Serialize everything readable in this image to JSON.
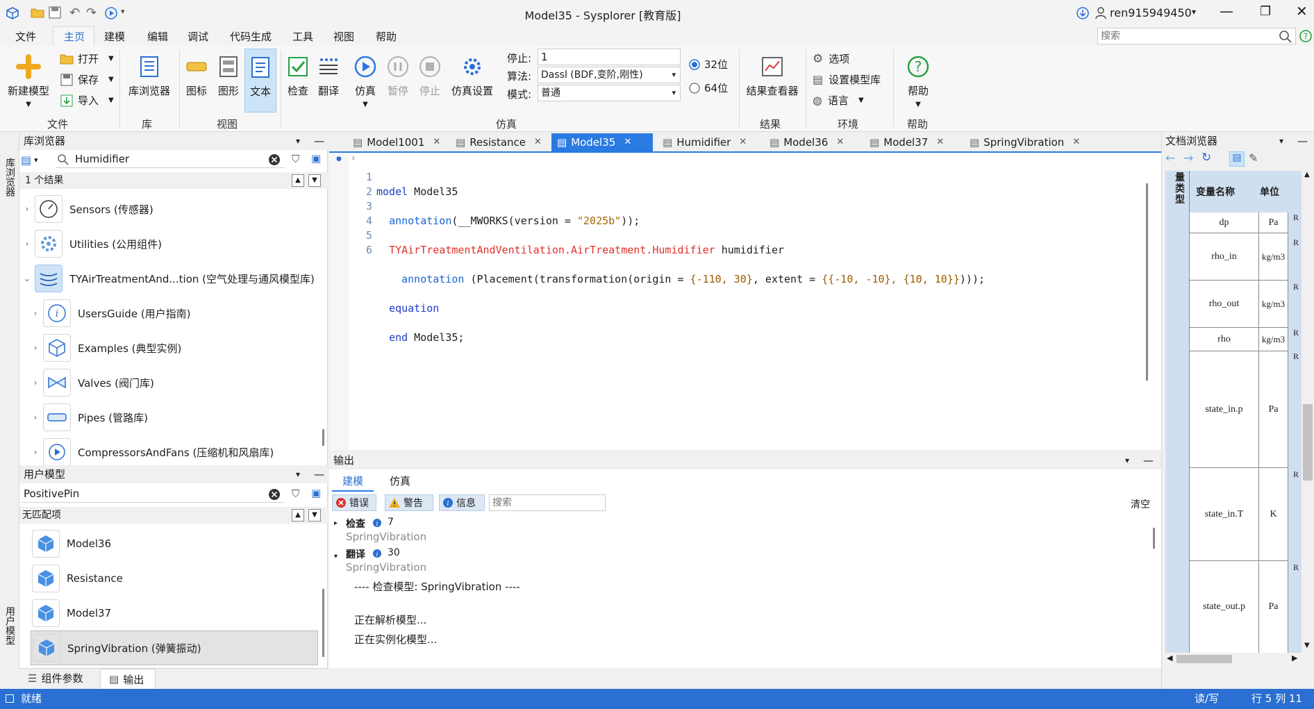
{
  "window": {
    "title": "Model35 - Sysplorer [教育版]",
    "user": "ren915949450"
  },
  "menu_tabs": [
    "文件",
    "主页",
    "建模",
    "编辑",
    "调试",
    "代码生成",
    "工具",
    "视图",
    "帮助"
  ],
  "search": {
    "placeholder": "搜索"
  },
  "ribbon": {
    "new_model": "新建模型",
    "open": "打开",
    "save": "保存",
    "import": "导入",
    "lib_browser": "库浏览器",
    "icon": "图标",
    "diagram": "图形",
    "text": "文本",
    "check": "检查",
    "translate": "翻译",
    "simulate": "仿真",
    "pause": "暂停",
    "stop": "停止",
    "sim_settings": "仿真设置",
    "stop_label": "停止:",
    "stop_value": "1",
    "algo_label": "算法:",
    "algo_value": "Dassl (BDF,变阶,刚性)",
    "mode_label": "模式:",
    "mode_value": "普通",
    "bit32": "32位",
    "bit64": "64位",
    "result_viewer": "结果查看器",
    "options": "选项",
    "set_lib": "设置模型库",
    "language": "语言",
    "help": "帮助",
    "groups": {
      "file": "文件",
      "lib": "库",
      "view": "视图",
      "sim": "仿真",
      "result": "结果",
      "env": "环境",
      "help": "帮助"
    }
  },
  "left_sidebar_tabs": {
    "lib": "库浏览器",
    "user": "用户模型"
  },
  "lib_browser": {
    "title": "库浏览器",
    "search_value": "Humidifier",
    "results": "1 个结果",
    "items": [
      "Sensors (传感器)",
      "Utilities (公用组件)",
      "TYAirTreatmentAnd...tion (空气处理与通风模型库)",
      "UsersGuide (用户指南)",
      "Examples (典型实例)",
      "Valves (阀门库)",
      "Pipes (管路库)",
      "CompressorsAndFans (压缩机和风扇库)"
    ]
  },
  "user_models": {
    "title": "用户模型",
    "search_value": "PositivePin",
    "results": "无匹配项",
    "items": [
      "Model36",
      "Resistance",
      "Model37",
      "SpringVibration (弹簧振动)"
    ]
  },
  "bottom_tabs": {
    "params": "组件参数",
    "output": "输出"
  },
  "doc_tabs": [
    "Model1001",
    "Resistance",
    "Model35",
    "Humidifier",
    "Model36",
    "Model37",
    "SpringVibration"
  ],
  "code": {
    "line_numbers": [
      "1",
      "2",
      "3",
      "4",
      "5",
      "6"
    ],
    "l1_kw": "model",
    "l1_rest": " Model35",
    "l2_kw": "annotation",
    "l2_a": "(__MWORKS(version = ",
    "l2_str": "\"2025b\"",
    "l2_b": "));",
    "l3_red": "TYAirTreatmentAndVentilation.AirTreatment.Humidifier",
    "l3_rest": " humidifier",
    "l4_kw": "annotation",
    "l4_a": " (Placement(transformation(origin = ",
    "l4_n1": "{-110, 30}",
    "l4_b": ", extent = ",
    "l4_n2": "{{-10, -10}, {10, 10}}",
    "l4_c": ")));",
    "l5_kw": "equation",
    "l6_kw": "end",
    "l6_rest": " Model35;"
  },
  "output": {
    "title": "输出",
    "tab_model": "建模",
    "tab_sim": "仿真",
    "btn_error": "错误",
    "btn_warn": "警告",
    "btn_info": "信息",
    "search_placeholder": "搜索",
    "clear": "清空",
    "check_label": "检查",
    "check_count": "7",
    "check_sub": "SpringVibration",
    "trans_label": "翻译",
    "trans_count": "30",
    "trans_sub": "SpringVibration",
    "log1": "---- 检查模型: SpringVibration ----",
    "log2": "正在解析模型...",
    "log3": "正在实例化模型..."
  },
  "doc_browser": {
    "title": "文档浏览器",
    "col_type": "量类型",
    "col_name": "变量名称",
    "col_unit": "单位",
    "rows": [
      {
        "name": "dp",
        "unit": "Pa"
      },
      {
        "name": "rho_in",
        "unit": "kg/m3"
      },
      {
        "name": "rho_out",
        "unit": "kg/m3"
      },
      {
        "name": "rho",
        "unit": "kg/m3"
      },
      {
        "name": "state_in.p",
        "unit": "Pa"
      },
      {
        "name": "state_in.T",
        "unit": "K"
      },
      {
        "name": "state_out.p",
        "unit": "Pa"
      }
    ],
    "edge_letter": "R"
  },
  "status": {
    "ready": "就绪",
    "rw": "读/写",
    "pos": "行 5 列 11"
  },
  "colors": {
    "accent": "#2a6fd1",
    "active_tab": "#2a7ae2",
    "selected": "#cce4f7"
  }
}
